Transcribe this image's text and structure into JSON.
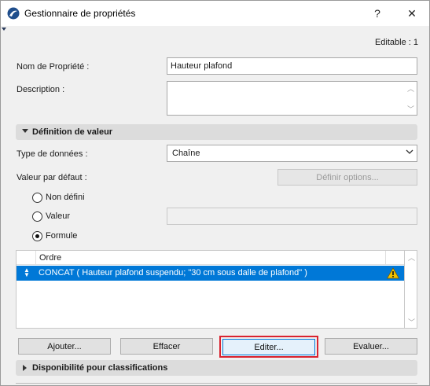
{
  "window": {
    "title": "Gestionnaire de propriétés",
    "help_label": "?",
    "close_label": "✕"
  },
  "header": {
    "editable_text": "Editable : 1"
  },
  "property": {
    "name_label": "Nom de Propriété :",
    "name_value": "Hauteur plafond",
    "description_label": "Description :",
    "description_value": ""
  },
  "value_section": {
    "title": "Définition de valeur",
    "expanded": true,
    "data_type_label": "Type de données :",
    "data_type_value": "Chaîne",
    "default_value_label": "Valeur par défaut :",
    "define_options_label": "Définir options...",
    "radio_options": [
      {
        "label": "Non défini",
        "checked": false
      },
      {
        "label": "Valeur",
        "checked": false
      },
      {
        "label": "Formule",
        "checked": true
      }
    ],
    "value_input": ""
  },
  "formula_list": {
    "column_header": "Ordre",
    "rows": [
      {
        "text": "CONCAT ( Hauteur plafond suspendu; \"30 cm sous dalle de plafond\" )",
        "selected": true,
        "warning": true
      }
    ]
  },
  "buttons": {
    "add": "Ajouter...",
    "delete": "Effacer",
    "edit": "Editer...",
    "evaluate": "Evaluer..."
  },
  "classification_section": {
    "title": "Disponibilité pour classifications",
    "expanded": false
  },
  "colors": {
    "selection": "#0078d7",
    "highlight_border": "#d9232f",
    "warning": "#f2c200"
  }
}
